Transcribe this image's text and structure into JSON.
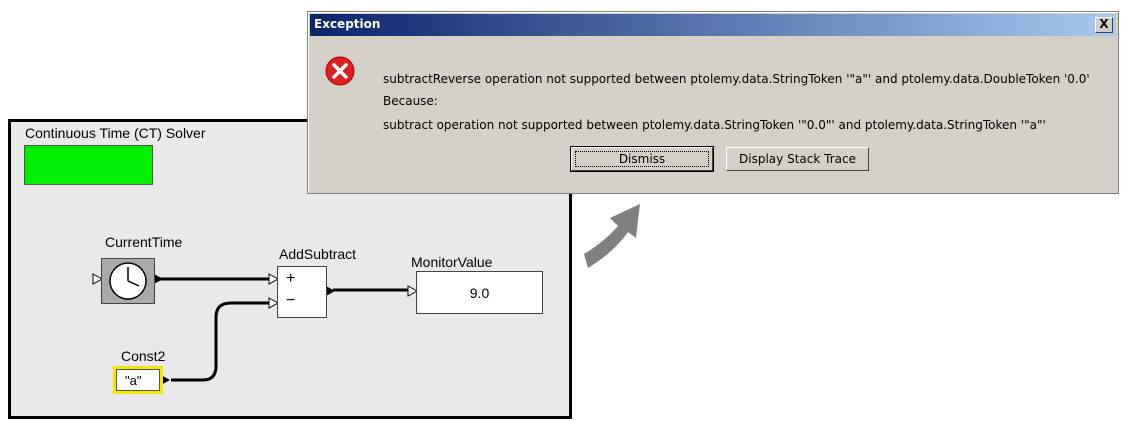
{
  "model": {
    "director_label": "Continuous Time (CT) Solver",
    "director_color": "#00ee00",
    "actors": {
      "current_time": {
        "label": "CurrentTime"
      },
      "add_subtract": {
        "label": "AddSubtract",
        "plus": "+",
        "minus": "−"
      },
      "monitor_value": {
        "label": "MonitorValue",
        "value": "9.0"
      },
      "const2": {
        "label": "Const2",
        "value": "\"a\""
      }
    }
  },
  "dialog": {
    "title": "Exception",
    "close_label": "X",
    "message_lines": [
      "subtractReverse operation not supported between ptolemy.data.StringToken '\"a\"' and ptolemy.data.DoubleToken '0.0'",
      "Because:",
      "subtract operation not supported between ptolemy.data.StringToken '\"0.0\"' and ptolemy.data.StringToken '\"a\"'"
    ],
    "buttons": {
      "dismiss": "Dismiss",
      "stack_trace": "Display Stack Trace"
    },
    "icon": "error-icon"
  },
  "colors": {
    "title_bar": "#0a246a",
    "dialog_bg": "#d4d0c8",
    "canvas_bg": "#e9e9e9",
    "arrow": "#808080"
  }
}
